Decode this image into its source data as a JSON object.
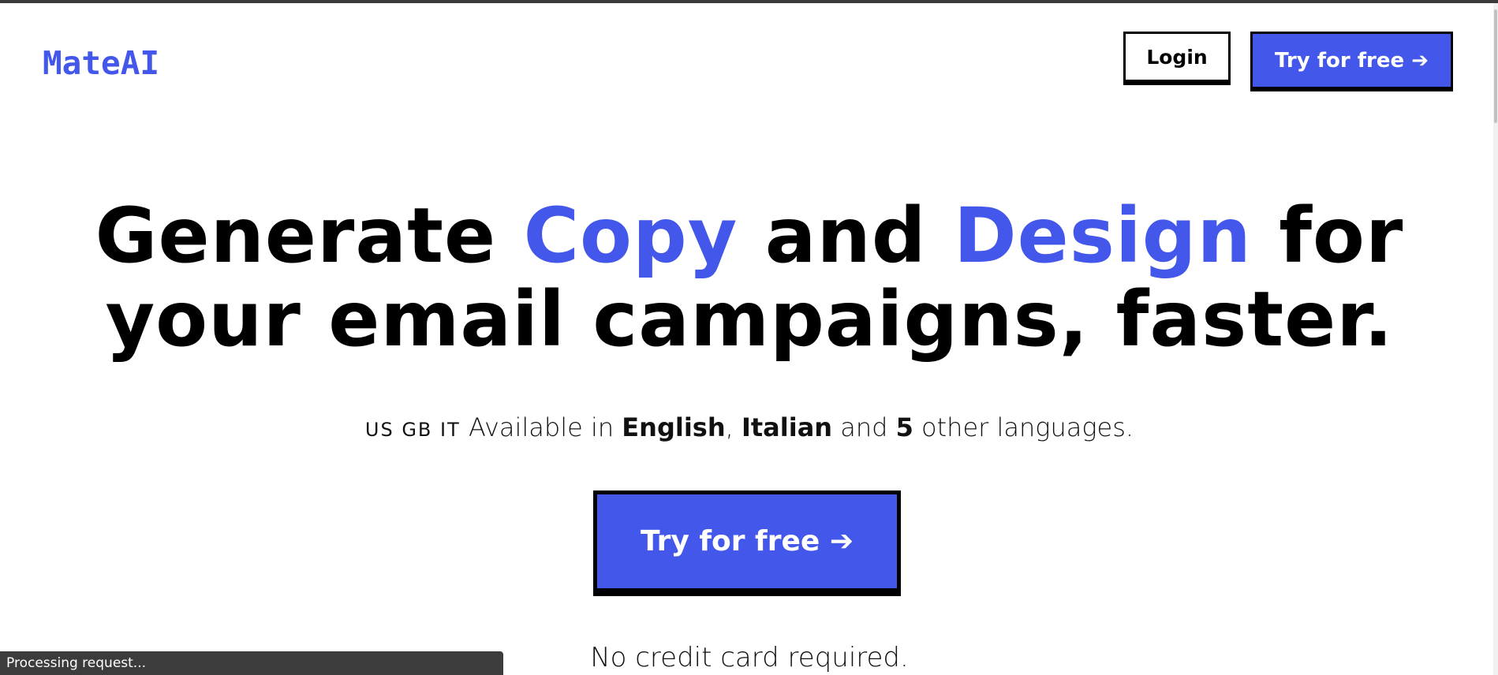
{
  "header": {
    "logo": "MateAI",
    "login_label": "Login",
    "try_label": "Try for free ➔"
  },
  "hero": {
    "headline": {
      "part1": "Generate ",
      "accent1": "Copy",
      "part2": " and ",
      "accent2": "Design",
      "part3": " for",
      "line2": "your email campaigns, faster."
    },
    "languages": {
      "flags": "US GB IT",
      "prefix": " Available in ",
      "lang1": "English",
      "sep1": ", ",
      "lang2": "Italian",
      "sep2": " and ",
      "count": "5",
      "suffix": " other languages."
    },
    "cta_label": "Try for free ➔",
    "note": "No credit card required."
  },
  "status_bar": {
    "text": "Processing request..."
  },
  "colors": {
    "accent": "#4357ea",
    "text": "#000000",
    "background": "#ffffff"
  }
}
